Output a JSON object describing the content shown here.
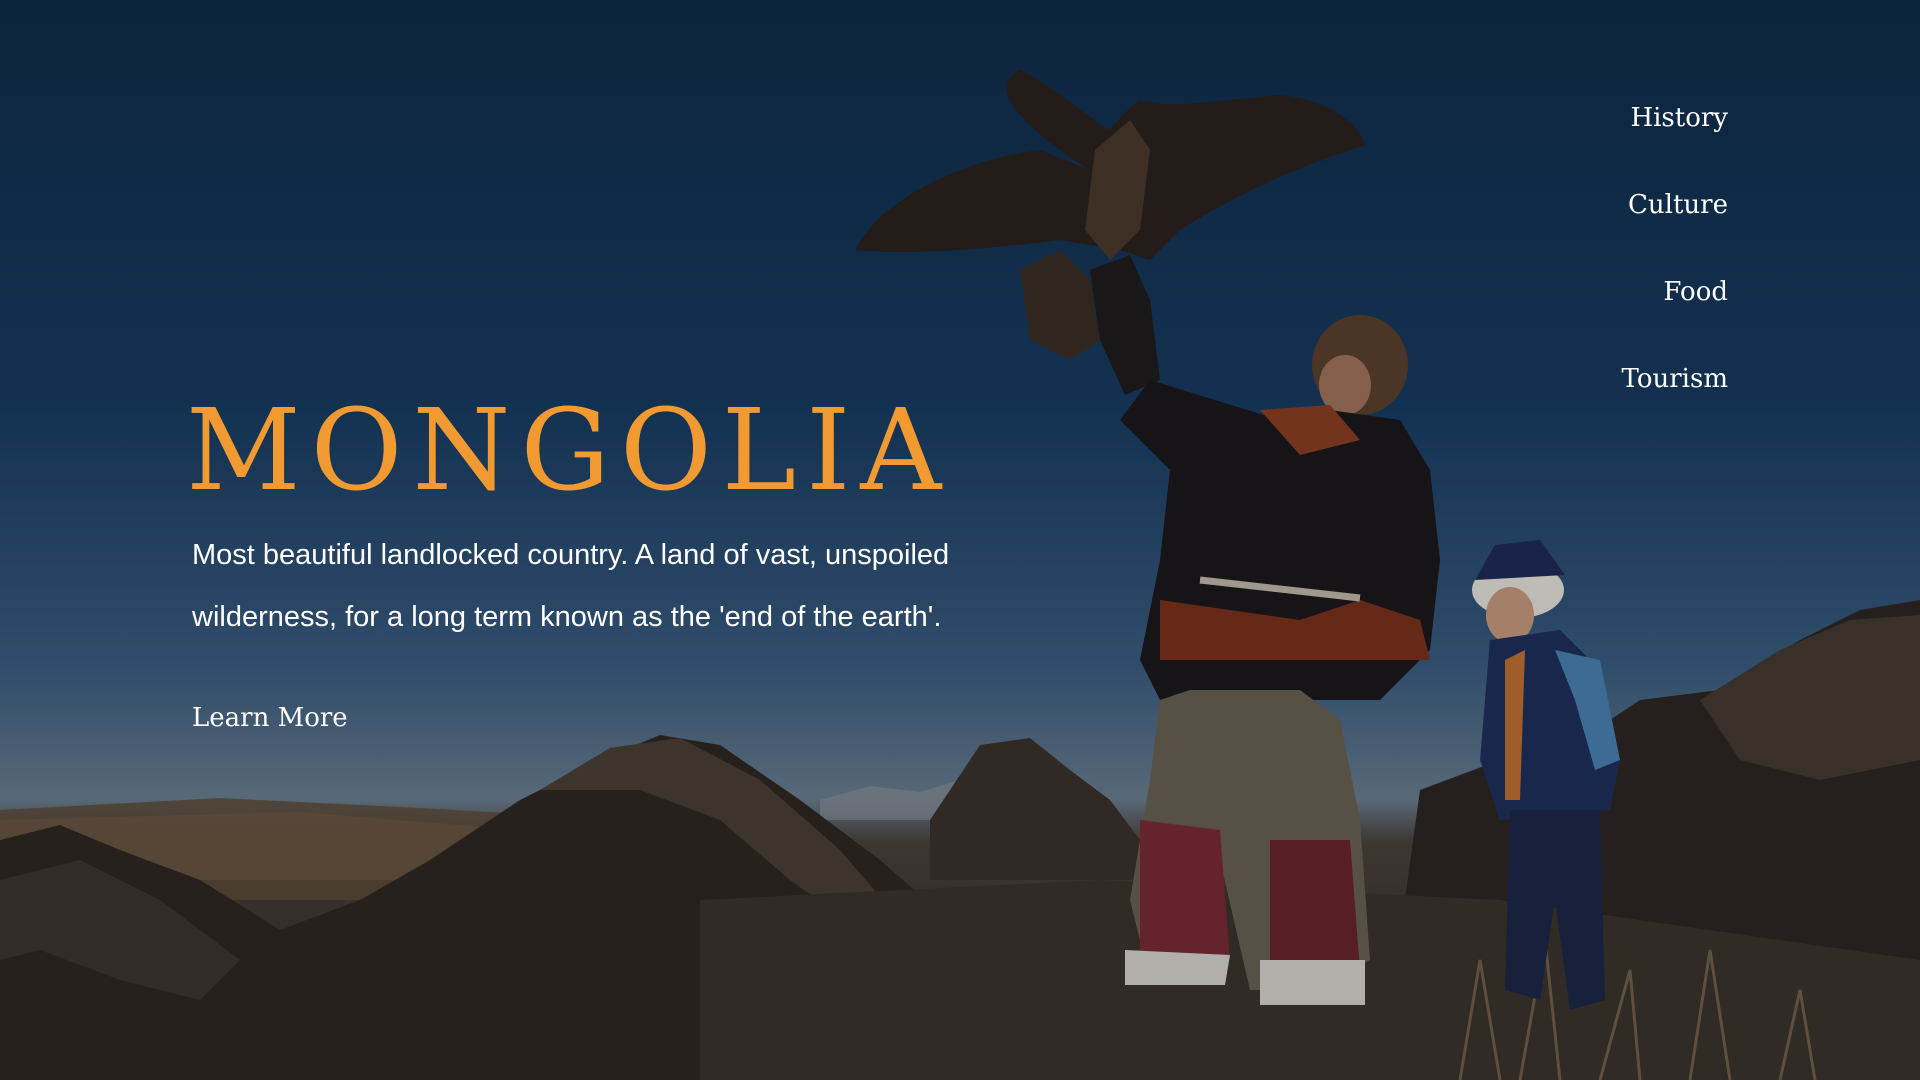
{
  "nav": {
    "items": [
      {
        "label": "History"
      },
      {
        "label": "Culture"
      },
      {
        "label": "Food"
      },
      {
        "label": "Tourism"
      }
    ]
  },
  "hero": {
    "title": "MONGOLIA",
    "tagline": "Most beautiful landlocked country. A land of vast, unspoiled wilderness, for a long term known as the 'end of the earth'.",
    "cta_label": "Learn More",
    "background": "eagle-hunter-photo"
  },
  "colors": {
    "accent": "#f19a31",
    "text": "#ffffff",
    "sky": "#12304f"
  }
}
